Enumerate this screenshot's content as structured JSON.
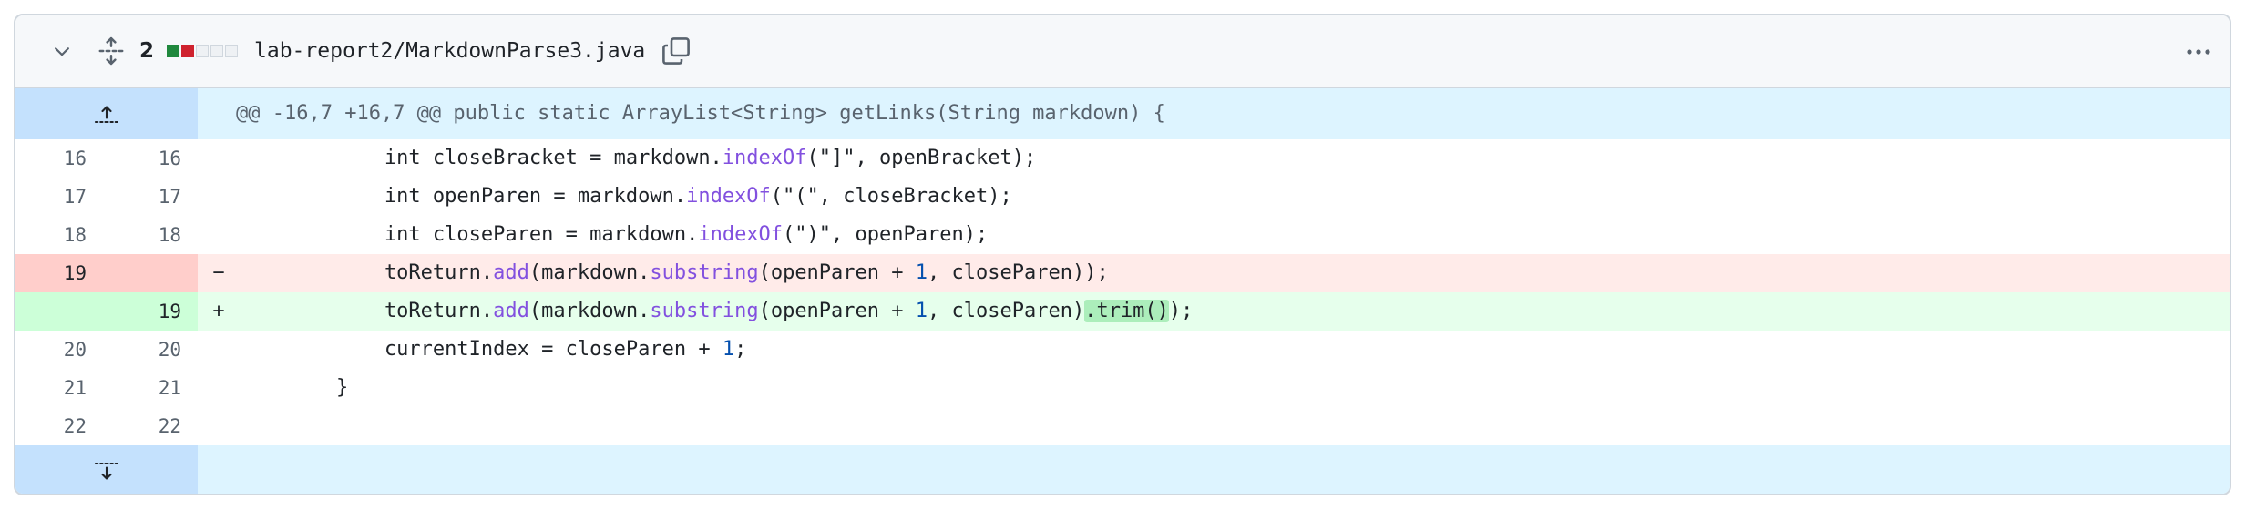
{
  "file": {
    "change_count": "2",
    "diffstat": [
      "added",
      "deleted",
      "neutral",
      "neutral",
      "neutral"
    ],
    "path": "lab-report2/MarkdownParse3.java"
  },
  "icons": {
    "collapse": "chevron-down-icon",
    "expand_all": "unfold-icon",
    "copy": "copy-icon",
    "more": "kebab-horizontal-icon",
    "expand_up": "expand-up-icon",
    "expand_down": "expand-down-icon"
  },
  "colors": {
    "added": "#1f883d",
    "deleted": "#cf222e",
    "hunk_bg": "#ddf4ff",
    "del_bg": "#ffebe9",
    "add_bg": "#e6ffec"
  },
  "hunk": {
    "header": "@@ -16,7 +16,7 @@ public static ArrayList<String> getLinks(String markdown) {"
  },
  "lines": [
    {
      "type": "context",
      "old": "16",
      "new": "16",
      "marker": "",
      "tokens": [
        {
          "t": "            int closeBracket = markdown."
        },
        {
          "t": "indexOf",
          "c": "k-fn"
        },
        {
          "t": "(\"]\", openBracket);"
        }
      ]
    },
    {
      "type": "context",
      "old": "17",
      "new": "17",
      "marker": "",
      "tokens": [
        {
          "t": "            int openParen = markdown."
        },
        {
          "t": "indexOf",
          "c": "k-fn"
        },
        {
          "t": "(\"(\", closeBracket);"
        }
      ]
    },
    {
      "type": "context",
      "old": "18",
      "new": "18",
      "marker": "",
      "tokens": [
        {
          "t": "            int closeParen = markdown."
        },
        {
          "t": "indexOf",
          "c": "k-fn"
        },
        {
          "t": "(\")\", openParen);"
        }
      ]
    },
    {
      "type": "del",
      "old": "19",
      "new": "",
      "marker": "−",
      "tokens": [
        {
          "t": "            toReturn."
        },
        {
          "t": "add",
          "c": "k-fn"
        },
        {
          "t": "(markdown."
        },
        {
          "t": "substring",
          "c": "k-fn"
        },
        {
          "t": "(openParen + "
        },
        {
          "t": "1",
          "c": "k-num"
        },
        {
          "t": ", closeParen));"
        }
      ]
    },
    {
      "type": "add",
      "old": "",
      "new": "19",
      "marker": "+",
      "tokens": [
        {
          "t": "            toReturn."
        },
        {
          "t": "add",
          "c": "k-fn"
        },
        {
          "t": "(markdown."
        },
        {
          "t": "substring",
          "c": "k-fn"
        },
        {
          "t": "(openParen + "
        },
        {
          "t": "1",
          "c": "k-num"
        },
        {
          "t": ", closeParen)"
        },
        {
          "t": ".trim()",
          "c": "hl-add"
        },
        {
          "t": ");"
        }
      ]
    },
    {
      "type": "context",
      "old": "20",
      "new": "20",
      "marker": "",
      "tokens": [
        {
          "t": "            currentIndex = closeParen + "
        },
        {
          "t": "1",
          "c": "k-num"
        },
        {
          "t": ";"
        }
      ]
    },
    {
      "type": "context",
      "old": "21",
      "new": "21",
      "marker": "",
      "tokens": [
        {
          "t": "        }"
        }
      ]
    },
    {
      "type": "context",
      "old": "22",
      "new": "22",
      "marker": "",
      "tokens": [
        {
          "t": ""
        }
      ]
    }
  ]
}
